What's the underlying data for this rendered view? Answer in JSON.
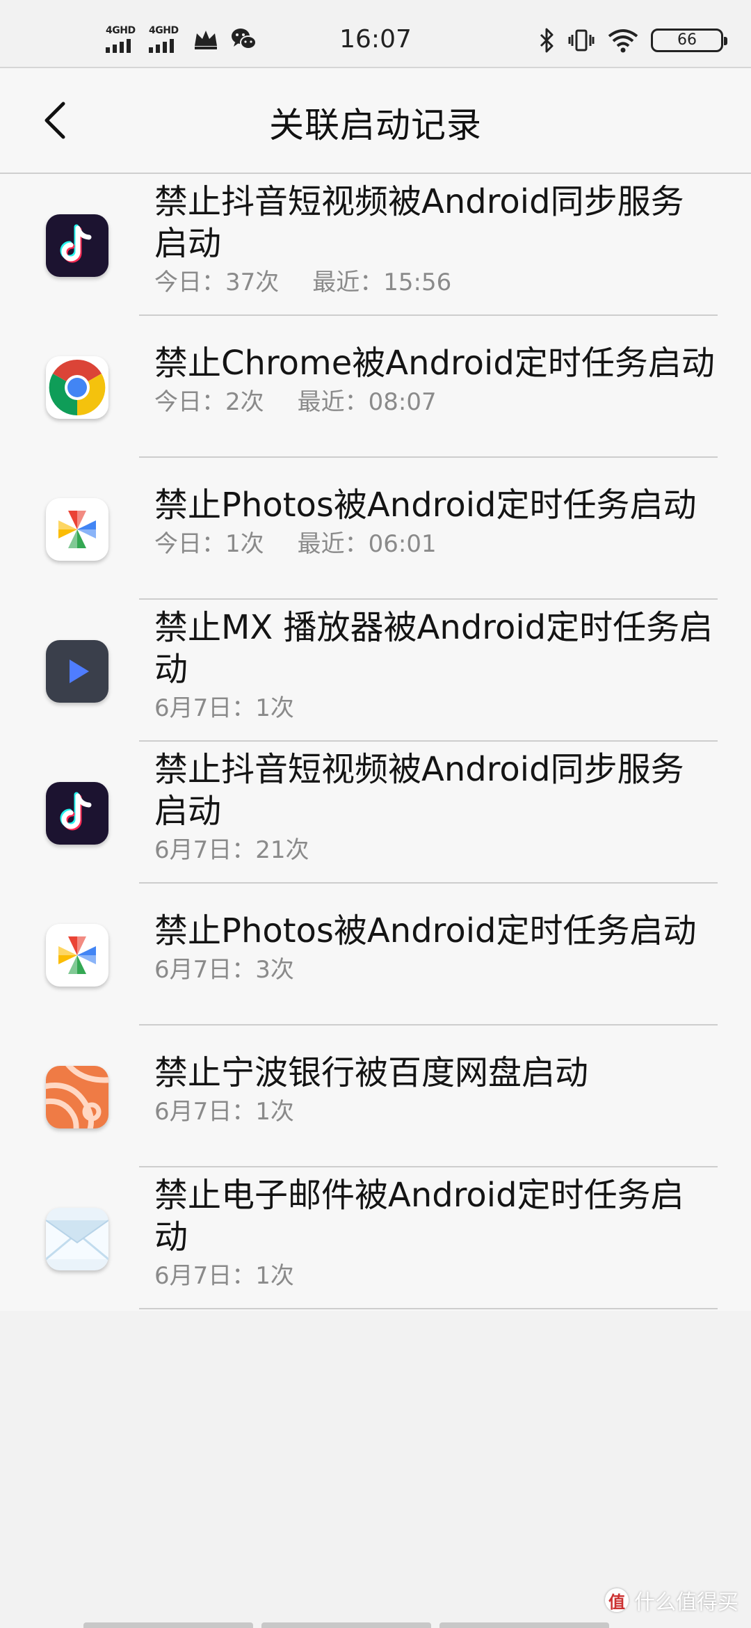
{
  "status_bar": {
    "sim1": "4GHD",
    "sim2": "4GHD",
    "time": "16:07",
    "battery": "66"
  },
  "header": {
    "title": "关联启动记录"
  },
  "records": [
    {
      "icon": "douyin-icon",
      "title": "禁止抖音短视频被Android同步服务启动",
      "meta1": "今日：37次",
      "meta2": "最近：15:56"
    },
    {
      "icon": "chrome-icon",
      "title": "禁止Chrome被Android定时任务启动",
      "meta1": "今日：2次",
      "meta2": "最近：08:07"
    },
    {
      "icon": "google-photos-icon",
      "title": "禁止Photos被Android定时任务启动",
      "meta1": "今日：1次",
      "meta2": "最近：06:01"
    },
    {
      "icon": "mx-player-icon",
      "title": "禁止MX 播放器被Android定时任务启动",
      "meta1": "6月7日：1次",
      "meta2": ""
    },
    {
      "icon": "douyin-icon",
      "title": "禁止抖音短视频被Android同步服务启动",
      "meta1": "6月7日：21次",
      "meta2": ""
    },
    {
      "icon": "google-photos-icon",
      "title": "禁止Photos被Android定时任务启动",
      "meta1": "6月7日：3次",
      "meta2": ""
    },
    {
      "icon": "bank-of-ningbo-icon",
      "title": "禁止宁波银行被百度网盘启动",
      "meta1": "6月7日：1次",
      "meta2": ""
    },
    {
      "icon": "email-icon",
      "title": "禁止电子邮件被Android定时任务启动",
      "meta1": "6月7日：1次",
      "meta2": ""
    }
  ],
  "watermark": {
    "badge": "值",
    "text": "什么值得买"
  }
}
